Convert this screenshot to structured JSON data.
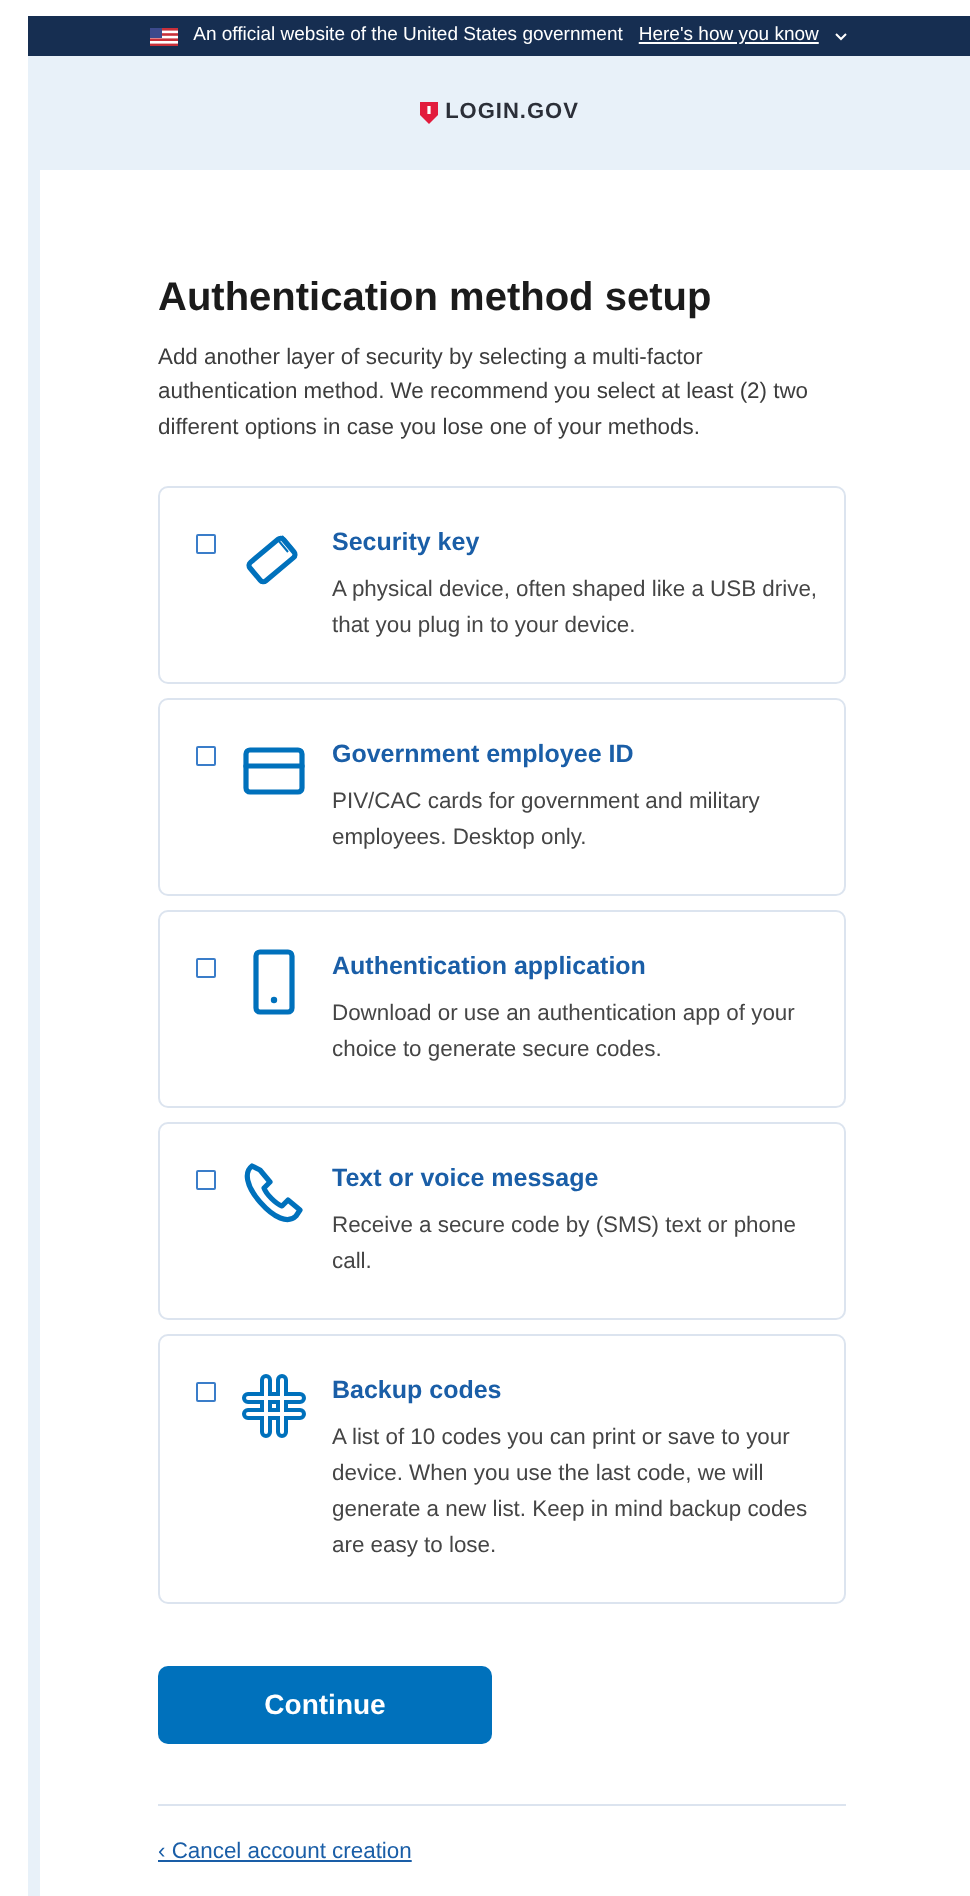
{
  "banner": {
    "text": "An official website of the United States government",
    "link": "Here's how you know",
    "expanded": false
  },
  "logo": {
    "text": "LOGIN.GOV"
  },
  "heading": "Authentication method setup",
  "intro": "Add another layer of security by selecting a multi-factor authentication method. We recommend you select at least (2) two different options in case you lose one of your methods.",
  "options": [
    {
      "kind": "key",
      "title": "Security key",
      "description": "A physical device, often shaped like a USB drive, that you plug in to your device.",
      "checked": false
    },
    {
      "kind": "card",
      "title": "Government employee ID",
      "description": "PIV/CAC cards for government and military employees. Desktop only.",
      "checked": false
    },
    {
      "kind": "phone",
      "title": "Authentication application",
      "description": "Download or use an authentication app of your choice to generate secure codes.",
      "checked": false
    },
    {
      "kind": "call",
      "title": "Text or voice message",
      "description": "Receive a secure code by (SMS) text or phone call.",
      "checked": false
    },
    {
      "kind": "hash",
      "title": "Backup codes",
      "description": "A list of 10 codes you can print or save to your device. When you use the last code, we will generate a new list. Keep in mind backup codes are easy to lose.",
      "checked": false
    }
  ],
  "button": "Continue",
  "cancel_link": "‹ Cancel account creation"
}
